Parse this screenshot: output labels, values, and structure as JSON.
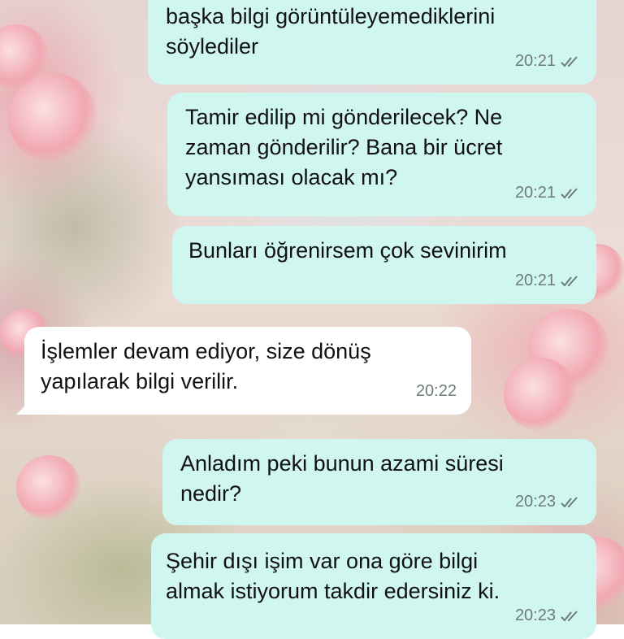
{
  "messages": [
    {
      "direction": "outgoing",
      "text": "başka bilgi görüntüleyemediklerini\nsöylediler",
      "time": "20:21",
      "status": "read"
    },
    {
      "direction": "outgoing",
      "text": "Tamir edilip mi gönderilecek? Ne\nzaman gönderilir? Bana bir ücret\nyansıması olacak mı?",
      "time": "20:21",
      "status": "read"
    },
    {
      "direction": "outgoing",
      "text": "Bunları öğrenirsem çok sevinirim",
      "time": "20:21",
      "status": "read"
    },
    {
      "direction": "incoming",
      "text": "İşlemler devam ediyor, size dönüş\nyapılarak bilgi verilir.",
      "time": "20:22"
    },
    {
      "direction": "outgoing",
      "text": "Anladım peki bunun azami süresi\nnedir?",
      "time": "20:23",
      "status": "read"
    },
    {
      "direction": "outgoing",
      "text": "Şehir dışı işim var ona göre bilgi\nalmak istiyorum takdir edersiniz ki.",
      "time": "20:23",
      "status": "read"
    }
  ],
  "colors": {
    "outgoing_bubble": "#cff6ef",
    "incoming_bubble": "#ffffff",
    "read_tick": "#6f7b7a",
    "timestamp": "#6f7b7a"
  },
  "icons": {
    "read_receipt": "double-check-icon"
  }
}
